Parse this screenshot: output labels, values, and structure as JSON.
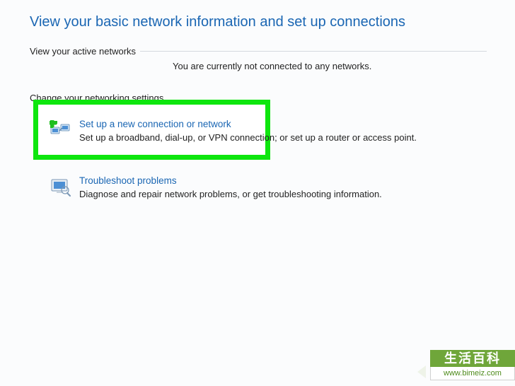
{
  "page": {
    "title": "View your basic network information and set up connections"
  },
  "activeNetworks": {
    "header": "View your active networks",
    "message": "You are currently not connected to any networks."
  },
  "changeSettings": {
    "header": "Change your networking settings"
  },
  "options": {
    "setup": {
      "title": "Set up a new connection or network",
      "desc": "Set up a broadband, dial-up, or VPN connection; or set up a router or access point."
    },
    "troubleshoot": {
      "title": "Troubleshoot problems",
      "desc": "Diagnose and repair network problems, or get troubleshooting information."
    }
  },
  "watermark": {
    "top": "生活百科",
    "url": "www.bimeiz.com"
  }
}
